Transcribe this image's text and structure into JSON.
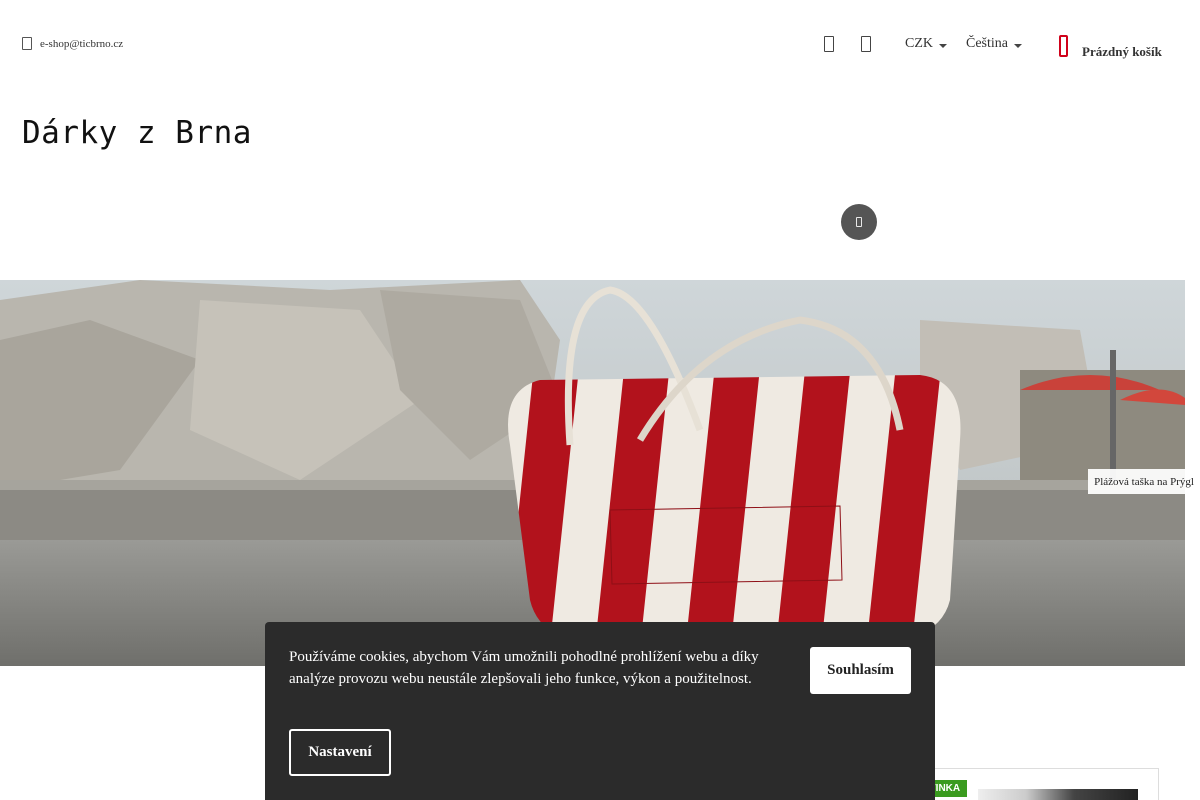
{
  "header": {
    "email": "e-shop@ticbrno.cz",
    "currency": "CZK",
    "language": "Čeština",
    "cart_label": "Prázdný košík",
    "icons": [
      "envelope-icon",
      "user-icon",
      "heart-icon",
      "cart-icon"
    ]
  },
  "logo": {
    "text": "Dárky z Brna"
  },
  "search": {
    "icon": "search-icon"
  },
  "banner": {
    "caption": "Plážová taška na Prýgl"
  },
  "product": {
    "badge": "NOVINKA",
    "badge_color": "#3a9b1f"
  },
  "cookie": {
    "message": "Používáme cookies, abychom Vám umožnili pohodlné prohlížení webu a díky analýze provozu webu neustále zlepšovali jeho funkce, výkon a použitelnost.",
    "accept_label": "Souhlasím",
    "settings_label": "Nastavení"
  },
  "colors": {
    "accent": "#d0021b",
    "cookie_bg": "#2b2b2b"
  }
}
